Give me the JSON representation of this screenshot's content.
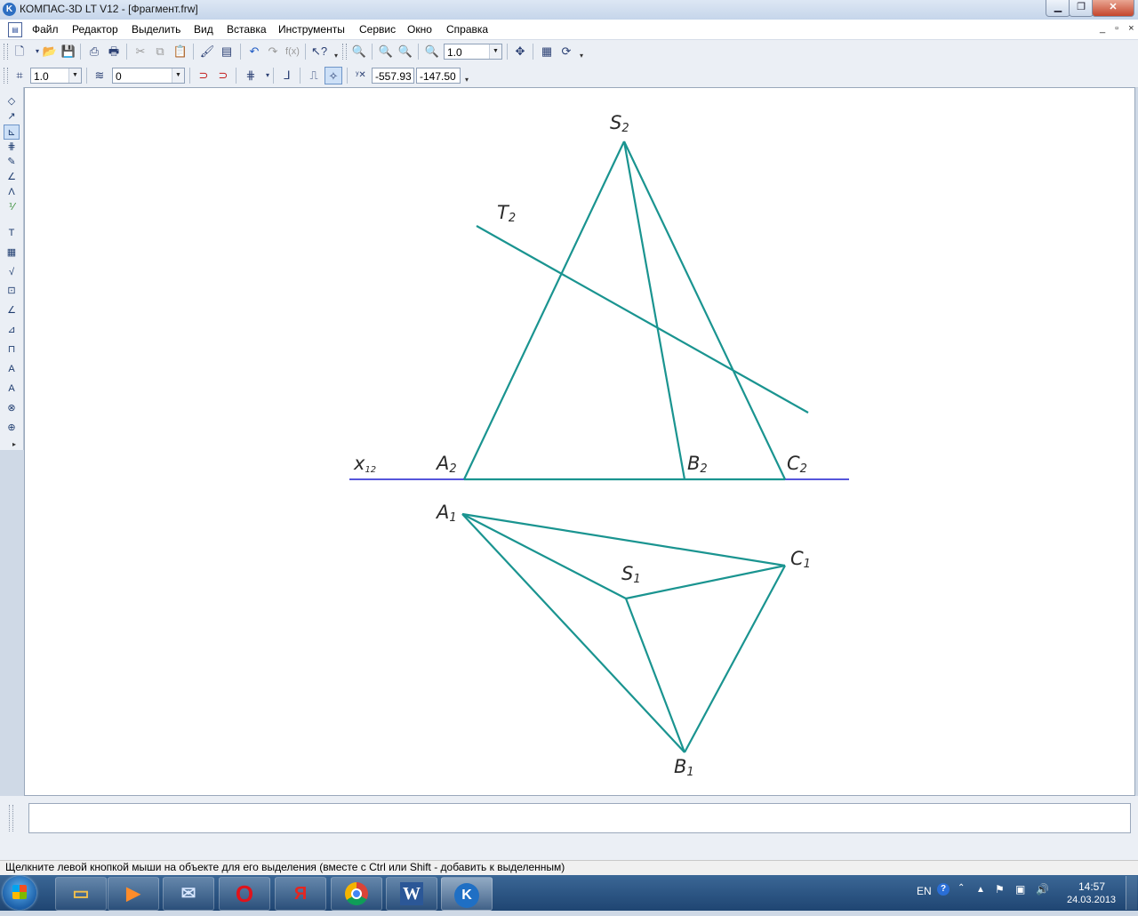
{
  "window": {
    "title": "КОМПАС-3D LT V12 - [Фрагмент.frw]",
    "minimize_icon": "minimize-icon",
    "maximize_icon": "restore-icon",
    "close_icon": "close-icon"
  },
  "menu": {
    "items": [
      "Файл",
      "Редактор",
      "Выделить",
      "Вид",
      "Вставка",
      "Инструменты",
      "Сервис",
      "Окно",
      "Справка"
    ]
  },
  "toolbar_standard": {
    "zoom_value": "1.0"
  },
  "toolbar_current_state": {
    "step_value": "1.0",
    "layer_value": "0",
    "coord_x": "-557.93",
    "coord_y": "-147.50"
  },
  "drawing": {
    "line_color": "#1a9490",
    "axis_color": "#1f1fcf",
    "labels": {
      "S2": {
        "main": "S",
        "sub": "2"
      },
      "T2": {
        "main": "T",
        "sub": "2"
      },
      "x12": {
        "main": "x",
        "sub": "12"
      },
      "A2": {
        "main": "A",
        "sub": "2"
      },
      "B2": {
        "main": "B",
        "sub": "2"
      },
      "C2": {
        "main": "C",
        "sub": "2"
      },
      "A1": {
        "main": "A",
        "sub": "1"
      },
      "C1": {
        "main": "C",
        "sub": "1"
      },
      "S1": {
        "main": "S",
        "sub": "1"
      },
      "B1": {
        "main": "B",
        "sub": "1"
      }
    }
  },
  "status": {
    "hint": "Щелкните левой кнопкой мыши на объекте для его выделения (вместе с Ctrl или Shift - добавить к выделенным)"
  },
  "taskbar": {
    "apps": [
      "explorer-icon",
      "media-player-icon",
      "mail-icon",
      "opera-icon",
      "yandex-icon",
      "chrome-icon",
      "word-icon",
      "kompas-icon"
    ],
    "yandex_letter": "Я",
    "word_letter": "W",
    "opera_letter": "O",
    "language": "EN",
    "time": "14:57",
    "date": "24.03.2013"
  }
}
